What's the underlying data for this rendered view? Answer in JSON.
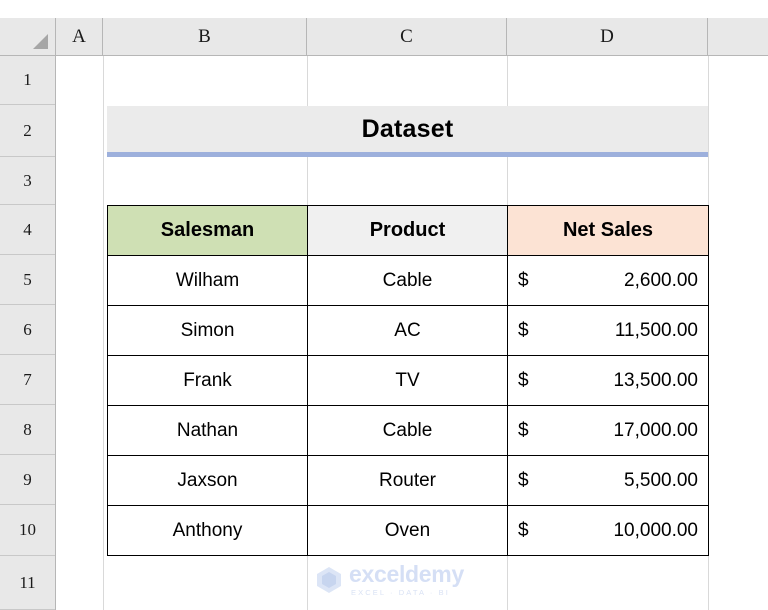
{
  "sheet": {
    "column_headers": [
      "A",
      "B",
      "C",
      "D"
    ],
    "row_headers": [
      "1",
      "2",
      "3",
      "4",
      "5",
      "6",
      "7",
      "8",
      "9",
      "10",
      "11"
    ]
  },
  "title": {
    "text": "Dataset",
    "background": "#ebebeb",
    "underline_color": "#9db0dc"
  },
  "table": {
    "headers": [
      "Salesman",
      "Product",
      "Net Sales"
    ],
    "header_colors": [
      "#cfe0b4",
      "#f0f0f0",
      "#fce3d4"
    ],
    "currency_symbol": "$",
    "rows": [
      {
        "salesman": "Wilham",
        "product": "Cable",
        "net_sales": "2,600.00"
      },
      {
        "salesman": "Simon",
        "product": "AC",
        "net_sales": "11,500.00"
      },
      {
        "salesman": "Frank",
        "product": "TV",
        "net_sales": "13,500.00"
      },
      {
        "salesman": "Nathan",
        "product": "Cable",
        "net_sales": "17,000.00"
      },
      {
        "salesman": "Jaxson",
        "product": "Router",
        "net_sales": "5,500.00"
      },
      {
        "salesman": "Anthony",
        "product": "Oven",
        "net_sales": "10,000.00"
      }
    ]
  },
  "watermark": {
    "name": "exceldemy",
    "tagline": "EXCEL · DATA · BI",
    "color": "#d3def5"
  }
}
